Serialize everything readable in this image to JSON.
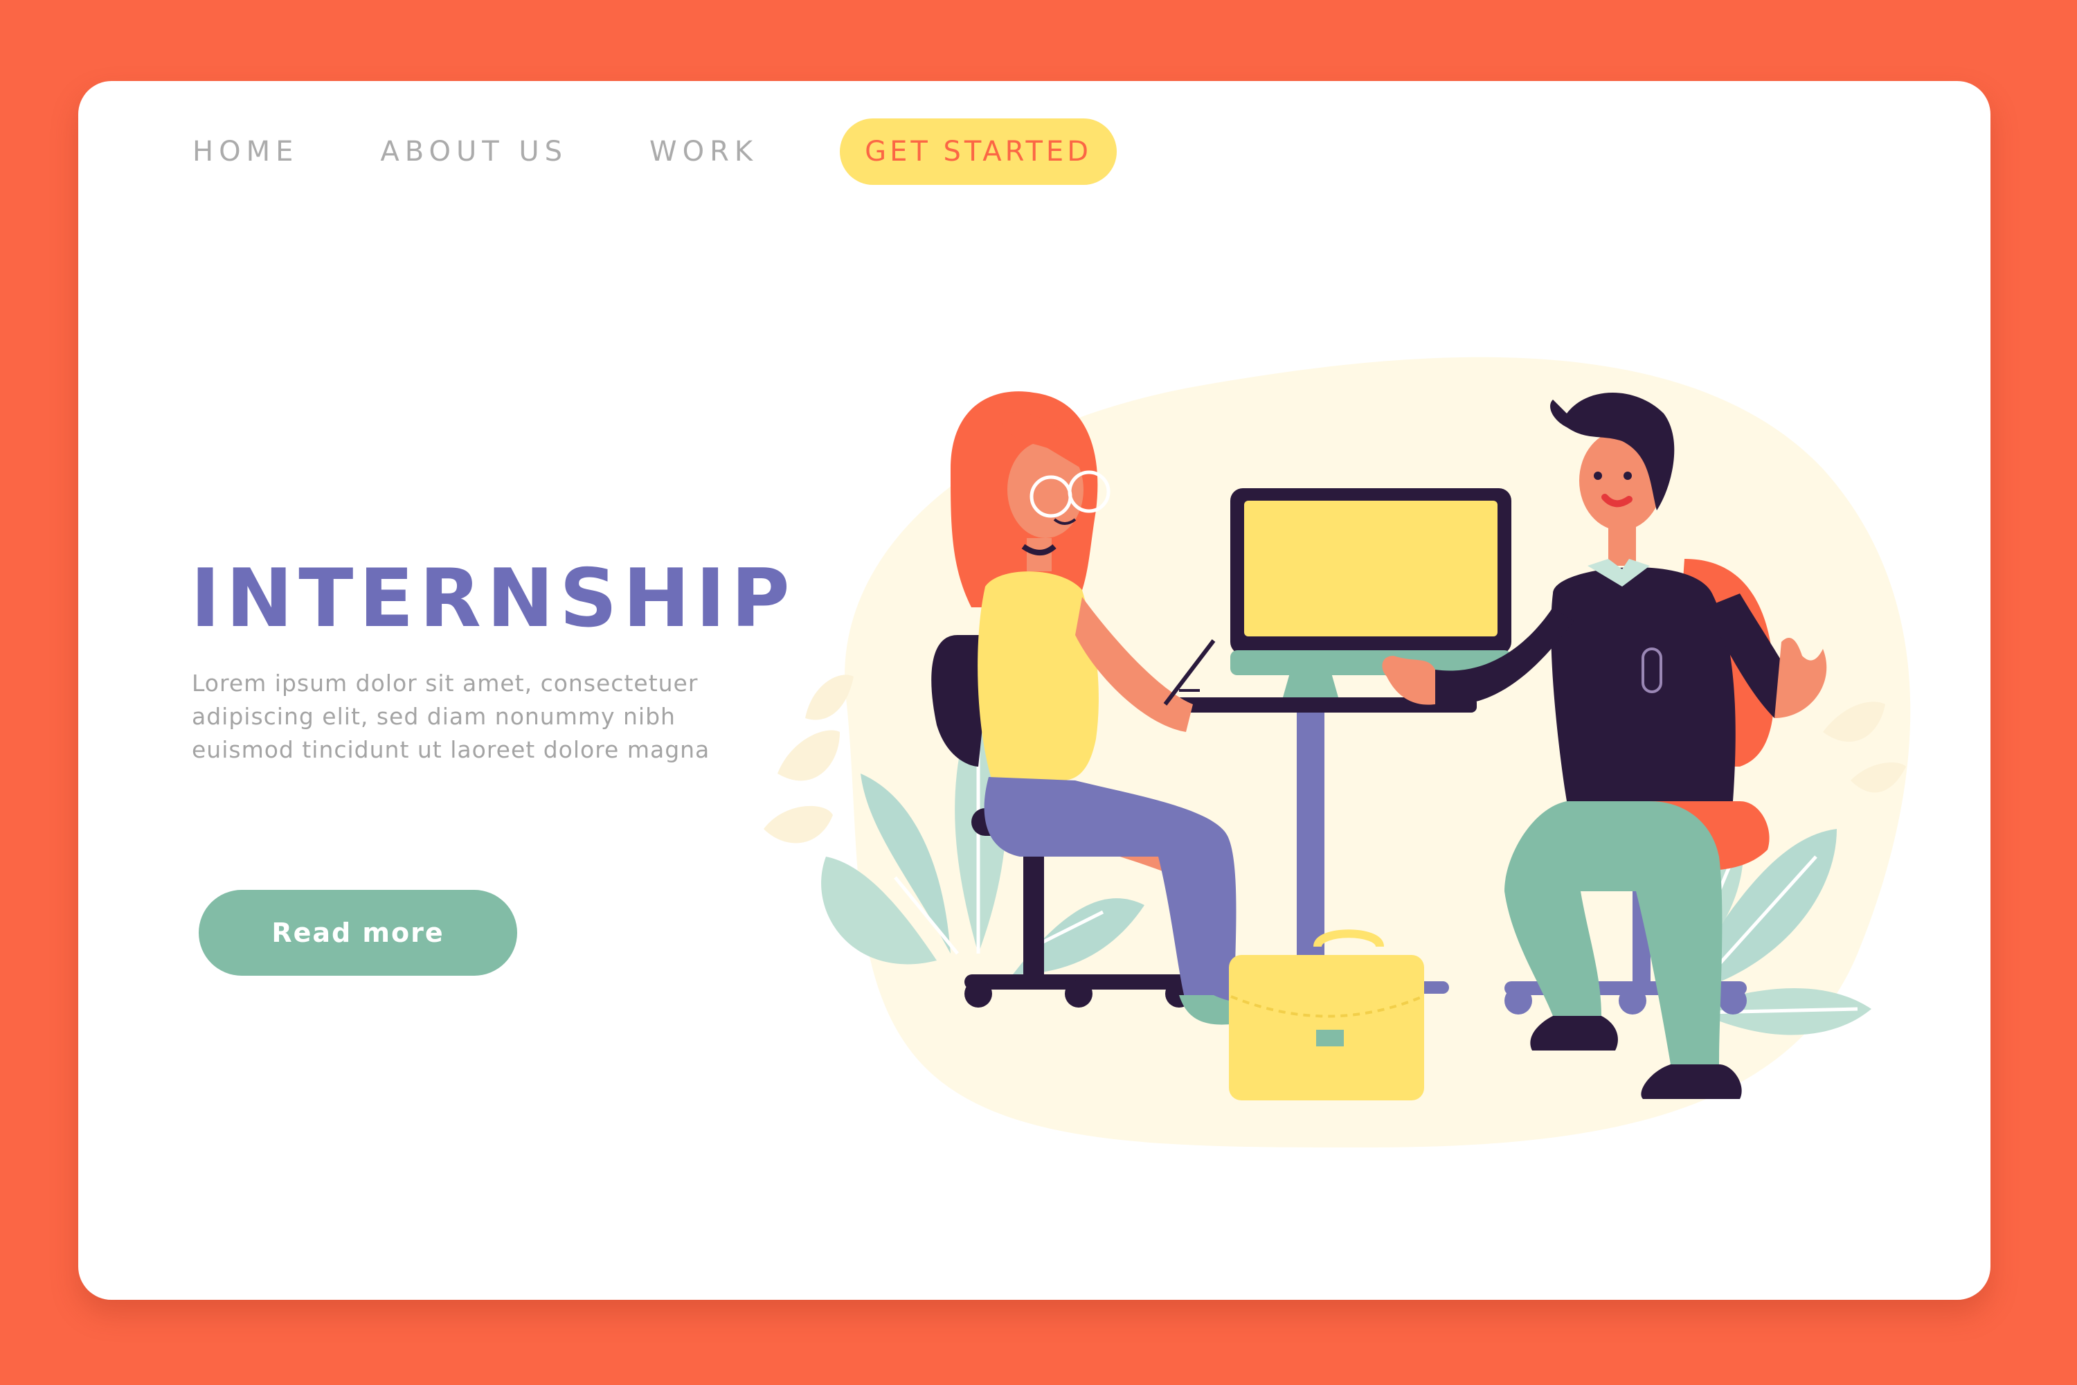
{
  "nav": {
    "items": [
      {
        "label": "HOME"
      },
      {
        "label": "ABOUT US"
      },
      {
        "label": "WORK"
      }
    ],
    "cta_label": "GET STARTED"
  },
  "hero": {
    "title": "INTERNSHIP",
    "lines": [
      "Lorem ipsum dolor sit amet, consectetuer",
      "adipiscing elit, sed diam nonummy nibh",
      "euismod tincidunt ut laoreet dolore magna"
    ],
    "button_label": "Read more"
  },
  "colors": {
    "page_background": "#FB6645",
    "card_background": "#FFFFFF",
    "accent_yellow": "#FFE36E",
    "title_purple": "#6E6EB8",
    "button_green": "#82BCA6",
    "nav_text": "#ABABAB",
    "body_text": "#A4A4A4",
    "dark_navy": "#2A1A3C"
  },
  "illustration": {
    "subject": "internship-interview-scene",
    "elements": [
      "woman-intern",
      "man-interviewer",
      "computer-monitor",
      "desk",
      "briefcase",
      "plants",
      "chairs"
    ]
  }
}
